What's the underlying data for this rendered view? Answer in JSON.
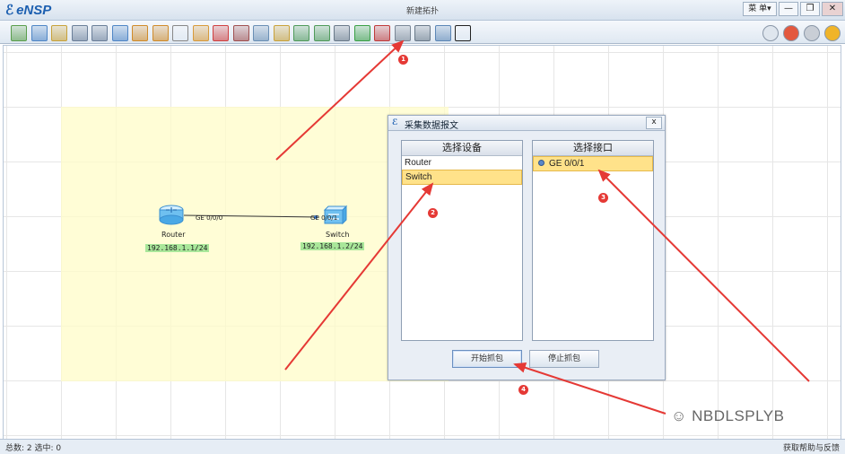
{
  "app": {
    "name": "eNSP",
    "window_title": "新建拓扑",
    "menu_label": "菜 单▾"
  },
  "window_buttons": [
    {
      "icon": "minimize-icon",
      "glyph": "—"
    },
    {
      "icon": "restore-icon",
      "glyph": "❐"
    },
    {
      "icon": "close-icon",
      "glyph": "✕"
    }
  ],
  "toolbar": {
    "left_tools": [
      "new-topology-icon",
      "new-test-icon",
      "open-icon",
      "save-icon",
      "save-as-icon",
      "print-icon",
      "undo-icon",
      "redo-icon",
      "select-icon",
      "drag-icon",
      "delete-icon",
      "delete-link-icon",
      "text-icon",
      "palette-icon",
      "zoom-in-icon",
      "zoom-out-icon",
      "fit-icon",
      "start-device-icon",
      "stop-device-icon",
      "capture-icon",
      "console-icon",
      "show-grid-icon",
      "topology-icon"
    ],
    "right_tools": [
      "chat-icon",
      "home-icon",
      "settings-icon",
      "help-icon"
    ]
  },
  "topology": {
    "router": {
      "label": "Router",
      "ip": "192.168.1.1/24",
      "port": "GE 0/0/0"
    },
    "switch": {
      "label": "Switch",
      "ip": "192.168.1.2/24",
      "port": "GE 0/0/1"
    }
  },
  "dialog": {
    "title": "采集数据报文",
    "close": "x",
    "device_panel": {
      "header": "选择设备",
      "items": [
        "Router",
        "Switch"
      ],
      "selected": "Switch"
    },
    "interface_panel": {
      "header": "选择接口",
      "items": [
        "GE 0/0/1"
      ],
      "selected": "GE 0/0/1"
    },
    "start_button": "开始抓包",
    "stop_button": "停止抓包"
  },
  "markers": [
    "1",
    "2",
    "3",
    "4"
  ],
  "watermark": "NBDLSPLYB",
  "status": {
    "left": "总数: 2 选中: 0",
    "right": "获取帮助与反馈"
  },
  "colors": {
    "accent": "#1c5fb0",
    "selection": "#ffe28a",
    "ip_highlight": "#a9e79a",
    "annotation_red": "#e53935",
    "area": "#fffcc8"
  }
}
